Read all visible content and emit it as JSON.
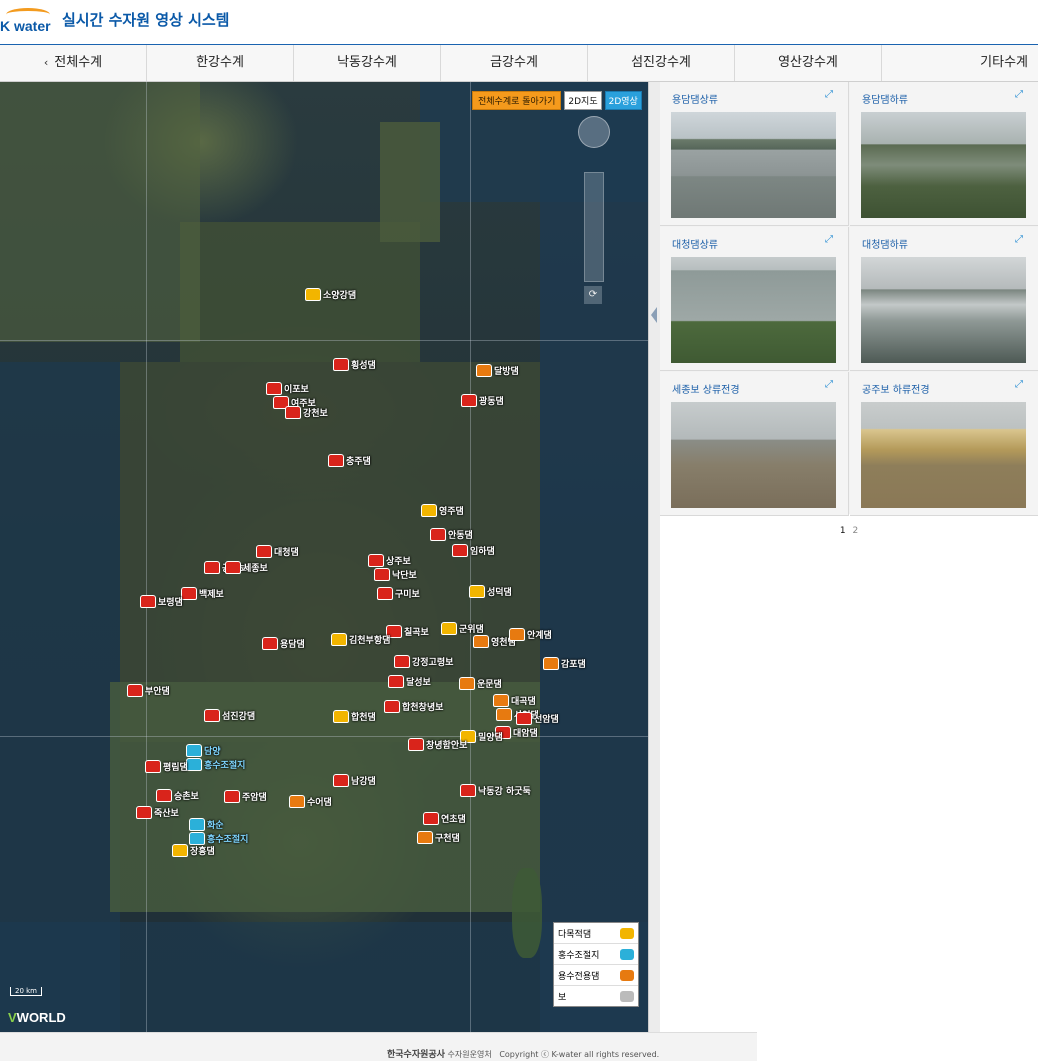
{
  "header": {
    "logo_text": "K water",
    "title": "실시간 수자원 영상 시스템"
  },
  "nav": {
    "items": [
      "전체수계",
      "한강수계",
      "낙동강수계",
      "금강수계",
      "섬진강수계",
      "영산강수계",
      "기타수계"
    ],
    "active_arrow": "‹"
  },
  "map": {
    "buttons": {
      "back": "전체수계로 돌아가기",
      "map2d": "2D지도",
      "video2d": "2D영상"
    },
    "scale_label": "20 km",
    "provider": "WORLD",
    "provider_v": "V",
    "markers": [
      {
        "label": "소양강댐",
        "type": "multi"
      },
      {
        "label": "횡성댐",
        "type": "weir"
      },
      {
        "label": "달방댐",
        "type": "water"
      },
      {
        "label": "이포보",
        "type": "weir"
      },
      {
        "label": "여주보",
        "type": "weir"
      },
      {
        "label": "강천보",
        "type": "weir"
      },
      {
        "label": "광동댐",
        "type": "weir"
      },
      {
        "label": "충주댐",
        "type": "weir"
      },
      {
        "label": "영주댐",
        "type": "multi"
      },
      {
        "label": "안동댐",
        "type": "weir"
      },
      {
        "label": "임하댐",
        "type": "weir"
      },
      {
        "label": "대청댐",
        "type": "weir"
      },
      {
        "label": "상주보",
        "type": "weir"
      },
      {
        "label": "공주보",
        "type": "weir"
      },
      {
        "label": "세종보",
        "type": "weir"
      },
      {
        "label": "낙단보",
        "type": "weir"
      },
      {
        "label": "백제보",
        "type": "weir"
      },
      {
        "label": "구미보",
        "type": "weir"
      },
      {
        "label": "성덕댐",
        "type": "multi"
      },
      {
        "label": "보령댐",
        "type": "weir"
      },
      {
        "label": "칠곡보",
        "type": "weir"
      },
      {
        "label": "군위댐",
        "type": "multi"
      },
      {
        "label": "영천댐",
        "type": "water"
      },
      {
        "label": "안계댐",
        "type": "water"
      },
      {
        "label": "용담댐",
        "type": "weir"
      },
      {
        "label": "김천부항댐",
        "type": "multi"
      },
      {
        "label": "강정고령보",
        "type": "weir"
      },
      {
        "label": "감포댐",
        "type": "water"
      },
      {
        "label": "달성보",
        "type": "weir"
      },
      {
        "label": "운문댐",
        "type": "water"
      },
      {
        "label": "부안댐",
        "type": "weir"
      },
      {
        "label": "대곡댐",
        "type": "water"
      },
      {
        "label": "사연댐",
        "type": "water"
      },
      {
        "label": "섬진강댐",
        "type": "weir"
      },
      {
        "label": "합천댐",
        "type": "multi"
      },
      {
        "label": "합천창녕보",
        "type": "weir"
      },
      {
        "label": "선암댐",
        "type": "weir"
      },
      {
        "label": "대암댐",
        "type": "weir"
      },
      {
        "label": "밀양댐",
        "type": "multi"
      },
      {
        "label": "담양",
        "type": "flood"
      },
      {
        "label": "홍수조절지",
        "type": "flood"
      },
      {
        "label": "창녕함안보",
        "type": "weir"
      },
      {
        "label": "평림댐",
        "type": "weir"
      },
      {
        "label": "남강댐",
        "type": "weir"
      },
      {
        "label": "승촌보",
        "type": "weir"
      },
      {
        "label": "주암댐",
        "type": "weir"
      },
      {
        "label": "수어댐",
        "type": "water"
      },
      {
        "label": "낙동강 하굿둑",
        "type": "weir"
      },
      {
        "label": "죽산보",
        "type": "weir"
      },
      {
        "label": "화순",
        "type": "flood"
      },
      {
        "label": "홍수조절지",
        "type": "flood"
      },
      {
        "label": "연초댐",
        "type": "weir"
      },
      {
        "label": "구천댐",
        "type": "water"
      },
      {
        "label": "장흥댐",
        "type": "multi"
      }
    ],
    "legend": [
      {
        "label": "다목적댐",
        "type": "multi"
      },
      {
        "label": "홍수조절지",
        "type": "flood"
      },
      {
        "label": "용수전용댐",
        "type": "water"
      },
      {
        "label": "보",
        "type": "weir"
      }
    ],
    "colors": {
      "multi": "#f2b500",
      "flood": "#2bb0d9",
      "water": "#e77a10",
      "weir": "#d9241b"
    }
  },
  "cameras": [
    {
      "title": "용담댐상류",
      "scene": "dam-gates"
    },
    {
      "title": "용담댐하류",
      "scene": "river-valley"
    },
    {
      "title": "대청댐상류",
      "scene": "lake-mist"
    },
    {
      "title": "대청댐하류",
      "scene": "spillway"
    },
    {
      "title": "세종보 상류전경",
      "scene": "bridge-fog"
    },
    {
      "title": "공주보 하류전경",
      "scene": "weir-gates"
    }
  ],
  "pager": {
    "current": "1",
    "next": "2"
  },
  "footer": {
    "org": "한국수자원공사",
    "dept": "수자원운영처",
    "copyright": "Copyright ⓒ K-water all rights reserved."
  }
}
